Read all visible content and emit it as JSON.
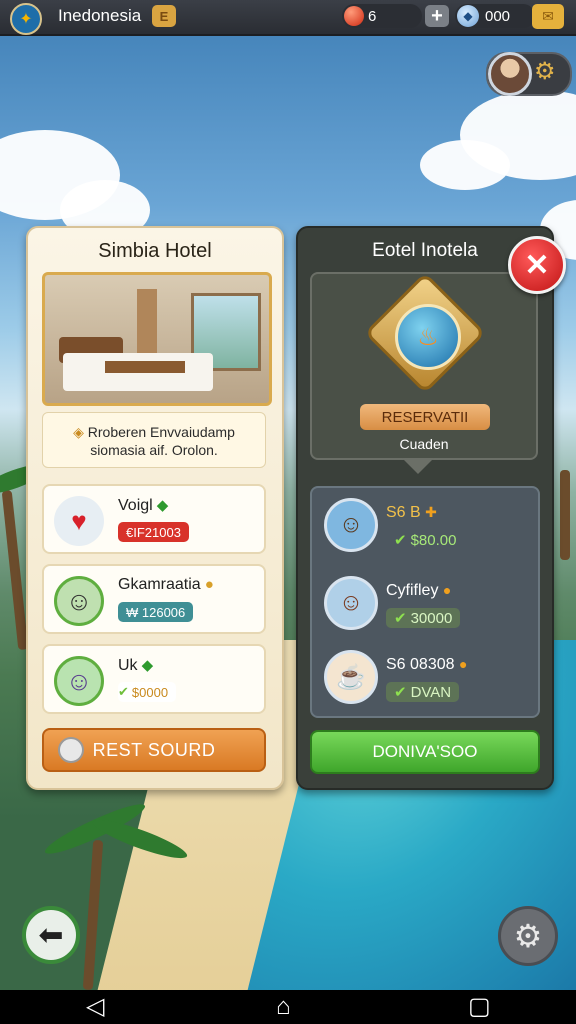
{
  "topbar": {
    "region_title": "Inedonesia",
    "coin_button": "E",
    "red_count": "6",
    "plus_label": "+",
    "gem_count": "000"
  },
  "left_panel": {
    "title": "Simbia Hotel",
    "description_line1": "Rroberen Envvaiudamp",
    "description_line2": "siomasia aif. Orolon.",
    "items": [
      {
        "name": "Voigl",
        "badge": "€IF21003",
        "badge_color": "#d8322a"
      },
      {
        "name": "Gkamraatia",
        "badge": "₩ 126006",
        "badge_color": "#3f8f95"
      },
      {
        "name": "Uk",
        "badge": "$0000",
        "badge_color": "#7a9b55"
      }
    ],
    "button_label": "REST SOURD"
  },
  "right_panel": {
    "title": "Eotel Inotela",
    "tag_label": "RESERVATII",
    "tag_sublabel": "Cuaden",
    "entries": [
      {
        "name": "S6 B",
        "value": "$80.00"
      },
      {
        "name": "Cyfifley",
        "value": "30000"
      },
      {
        "name": "S6 08308",
        "value": "DVAN"
      }
    ],
    "button_label": "DONIVA'SOO"
  },
  "colors": {
    "accent_orange": "#d97a24",
    "accent_green": "#3fa62b",
    "close_red": "#c01414"
  }
}
